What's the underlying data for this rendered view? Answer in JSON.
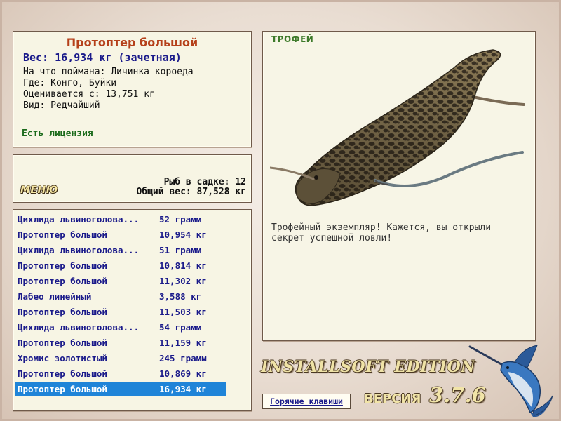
{
  "fish_info": {
    "title": "Протоптер большой",
    "weight": "Вес: 16,934 кг (зачетная)",
    "bait": "На что поймана: Личинка короеда",
    "location": "Где: Конго, Буйки",
    "estimate": "Оценивается с: 13,751 кг",
    "rarity": "Вид: Редчайший",
    "license": "Есть лицензия"
  },
  "stats": {
    "menu_label": "МЕНЮ",
    "fish_count": "Рыб в садке: 12",
    "total_weight": "Общий вес: 87,528 кг"
  },
  "catch_list": [
    {
      "name": "Цихлида львиноголова...",
      "weight": "52 грамм"
    },
    {
      "name": "Протоптер большой",
      "weight": "10,954 кг"
    },
    {
      "name": "Цихлида львиноголова...",
      "weight": "51 грамм"
    },
    {
      "name": "Протоптер большой",
      "weight": "10,814 кг"
    },
    {
      "name": "Протоптер большой",
      "weight": "11,302 кг"
    },
    {
      "name": "Лабео линейный",
      "weight": "3,588 кг"
    },
    {
      "name": "Протоптер большой",
      "weight": "11,503 кг"
    },
    {
      "name": "Цихлида львиноголова...",
      "weight": "54 грамм"
    },
    {
      "name": "Протоптер большой",
      "weight": "11,159 кг"
    },
    {
      "name": "Хромис золотистый",
      "weight": "245 грамм"
    },
    {
      "name": "Протоптер большой",
      "weight": "10,869 кг"
    },
    {
      "name": "Протоптер большой",
      "weight": "16,934 кг"
    }
  ],
  "selected_index": 11,
  "trophy": {
    "label": "ТРОФЕЙ",
    "description": "Трофейный экземпляр! Кажется, вы открыли секрет успешной ловли!"
  },
  "branding": {
    "edition": "INSTALLSOFT EDITION",
    "version_label": "ВЕРСИЯ",
    "version_number": "3.7.6"
  },
  "hotkeys_label": "Горячие клавиши",
  "colors": {
    "title": "#b5401a",
    "list_text": "#1a1a8a",
    "selection": "#1f84d8",
    "license": "#1a6a1a"
  }
}
